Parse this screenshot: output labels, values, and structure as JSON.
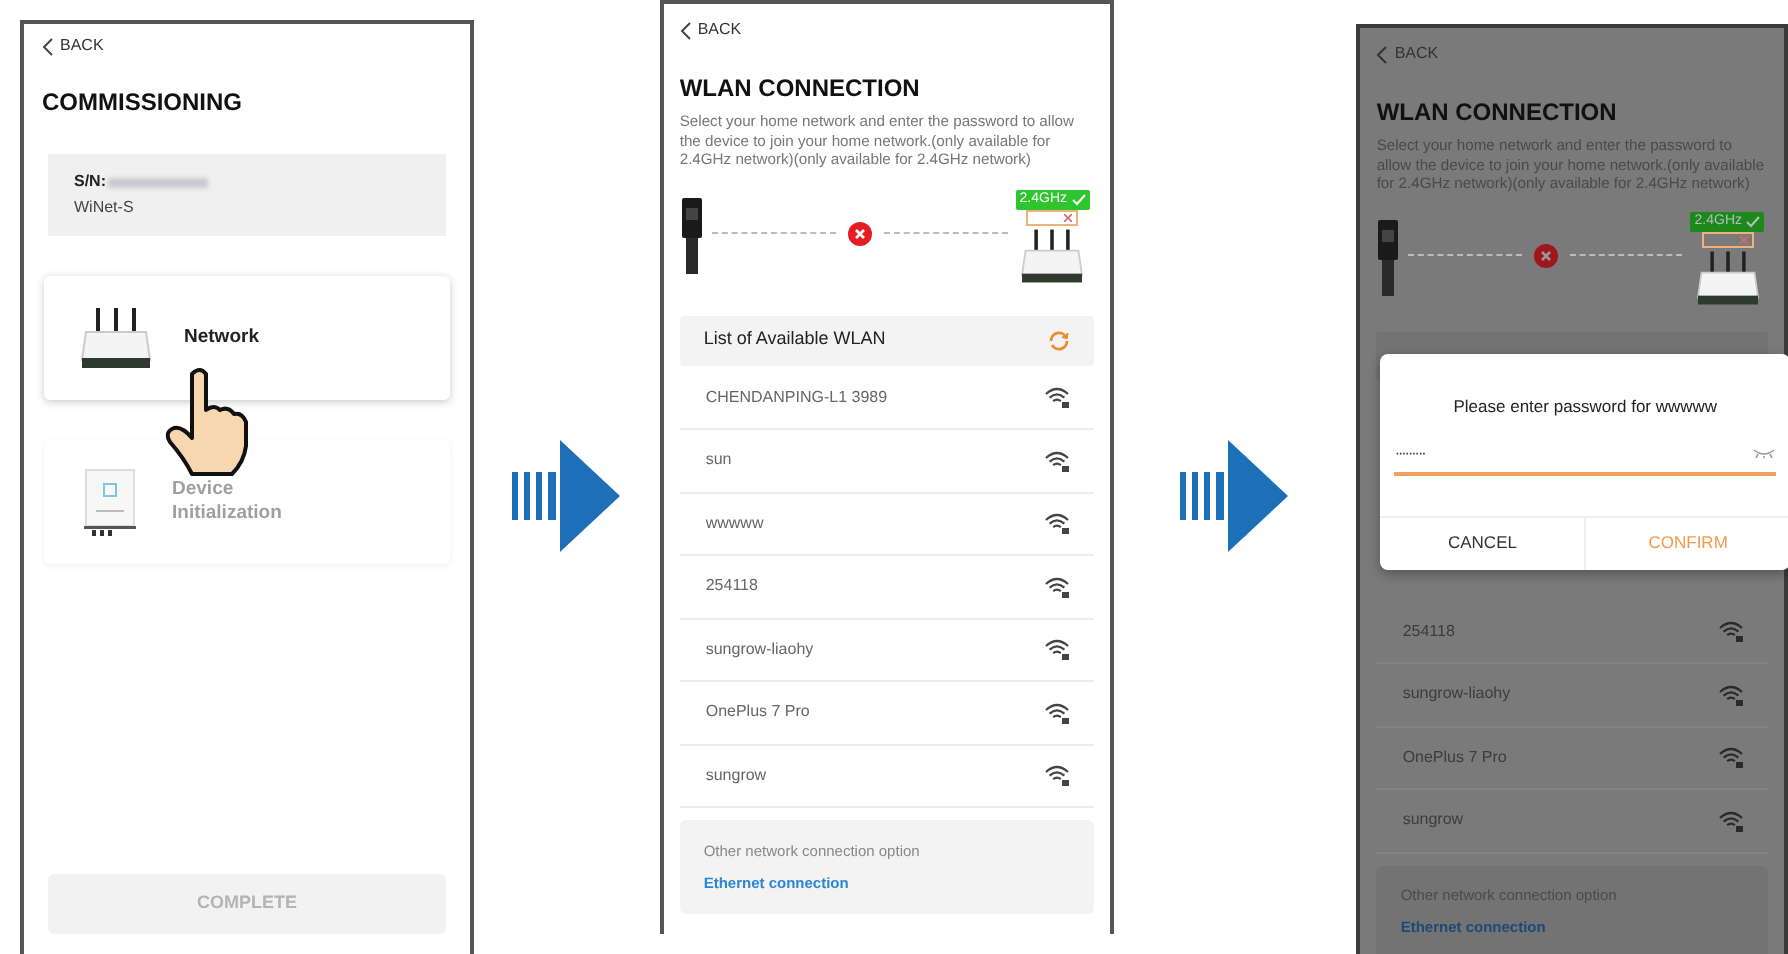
{
  "screens": [
    {
      "kind": "commissioning",
      "back": "BACK",
      "title": "COMMISSIONING",
      "device": {
        "serial_label": "S/N:",
        "model": "WiNet-S"
      },
      "options": [
        {
          "label": "Network",
          "kind": "router",
          "disabled": false
        },
        {
          "label": "Device Initialization",
          "kind": "inverter",
          "disabled": true
        }
      ],
      "complete_button": {
        "label": "COMPLETE",
        "disabled": true
      }
    },
    {
      "kind": "wlan",
      "dimmed": false,
      "back": "BACK",
      "title": "WLAN CONNECTION",
      "description": "Select your home network and enter the password to allow the device to join your home network.(only available for 2.4GHz network)(only available for 2.4GHz network)",
      "band_badge": "2.4GHz",
      "list_header": "List of Available WLAN",
      "networks": [
        "CHENDANPING-L1 3989",
        "sun",
        "wwwww",
        "254118",
        "sungrow-liaohy",
        "OnePlus 7 Pro",
        "sungrow"
      ],
      "other_option": {
        "text": "Other network connection option",
        "link": "Ethernet connection"
      }
    },
    {
      "kind": "wlan",
      "dimmed": true,
      "back": "BACK",
      "title": "WLAN CONNECTION",
      "description": "Select your home network and enter the password to allow the device to join your home network.(only available for 2.4GHz network)(only available for 2.4GHz network)",
      "band_badge": "2.4GHz",
      "networks": [
        "254118",
        "sungrow-liaohy",
        "OnePlus 7 Pro",
        "sungrow"
      ],
      "other_option": {
        "text": "Other network connection option",
        "link": "Ethernet connection"
      },
      "dialog": {
        "title": "Please enter password for wwwww",
        "value": "·········",
        "cancel": "CANCEL",
        "confirm": "CONFIRM"
      }
    }
  ]
}
